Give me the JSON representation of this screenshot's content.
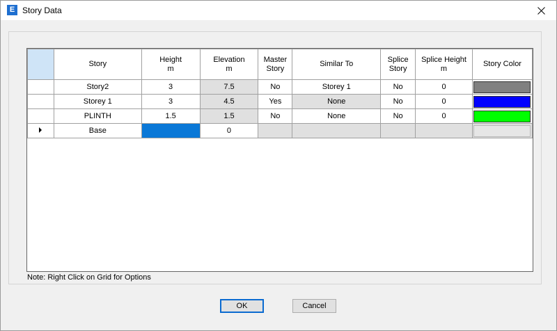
{
  "window": {
    "title": "Story Data",
    "icon_letter": "E"
  },
  "columns": [
    {
      "title": "Story",
      "unit": ""
    },
    {
      "title": "Height",
      "unit": "m"
    },
    {
      "title": "Elevation",
      "unit": "m"
    },
    {
      "title": "Master Story",
      "unit": ""
    },
    {
      "title": "Similar To",
      "unit": ""
    },
    {
      "title": "Splice Story",
      "unit": ""
    },
    {
      "title": "Splice Height",
      "unit": "m"
    },
    {
      "title": "Story Color",
      "unit": ""
    }
  ],
  "rows": [
    {
      "story": "Story2",
      "height": "3",
      "elevation": "7.5",
      "master": "No",
      "similar": "Storey 1",
      "splice": "No",
      "splice_height": "0",
      "color": "#808080"
    },
    {
      "story": "Storey 1",
      "height": "3",
      "elevation": "4.5",
      "master": "Yes",
      "similar": "None",
      "splice": "No",
      "splice_height": "0",
      "color": "#0000ff"
    },
    {
      "story": "PLINTH",
      "height": "1.5",
      "elevation": "1.5",
      "master": "No",
      "similar": "None",
      "splice": "No",
      "splice_height": "0",
      "color": "#00ff00"
    },
    {
      "story": "Base",
      "height": "",
      "elevation": "0",
      "master": "",
      "similar": "",
      "splice": "",
      "splice_height": "",
      "color": ""
    }
  ],
  "note": "Note:  Right Click on Grid for Options",
  "buttons": {
    "ok": "OK",
    "cancel": "Cancel"
  },
  "colors": {
    "selection": "#0a78d7",
    "readonly_cell": "#e0e0e0",
    "header_corner": "#cfe4f7"
  }
}
